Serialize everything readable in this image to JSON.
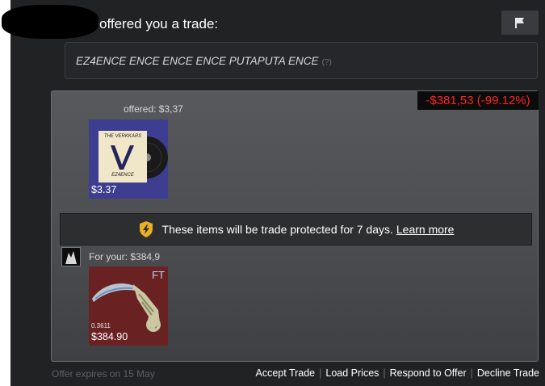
{
  "header": {
    "title": "offered you a trade:",
    "flag_icon": "flag-icon"
  },
  "message": {
    "text": "EZ4ENCE ENCE ENCE ENCE PUTAPUTA ENCE",
    "help": "(?)"
  },
  "offer": {
    "loss_badge": "-$381,53 (-99.12%)",
    "loss_color": "#ff2222",
    "offered_label": "offered: $3,37",
    "their_item": {
      "art_title": "THE VERKKARS",
      "art_caption": "EZ4ENCE",
      "price": "$3.37",
      "tile_color": "#3d3e91"
    },
    "protection": {
      "icon": "shield-lightning-icon",
      "text": "These items will be trade protected for 7 days.",
      "link": "Learn more"
    },
    "for_your_label": "For your: $384,9",
    "your_item": {
      "wear": "FT",
      "float": "0.3611",
      "price": "$384.90",
      "tile_color": "#6a2122"
    }
  },
  "footer": {
    "expires": "Offer expires on 15 May",
    "actions": [
      "Accept Trade",
      "Load Prices",
      "Respond to Offer",
      "Decline Trade"
    ]
  }
}
